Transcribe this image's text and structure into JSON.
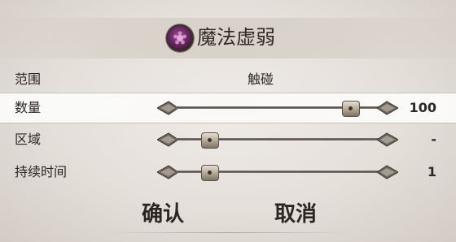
{
  "dialog": {
    "title": "魔法虚弱",
    "icon": "magic-weakness-icon"
  },
  "rows": [
    {
      "label": "范围",
      "value": "触碰"
    },
    {
      "label": "数量",
      "value": "100",
      "slider_fraction": 0.91
    },
    {
      "label": "区域",
      "value": "-",
      "slider_fraction": 0.11
    },
    {
      "label": "持续时间",
      "value": "1",
      "slider_fraction": 0.11
    }
  ],
  "buttons": {
    "confirm": "确认",
    "cancel": "取消"
  },
  "colors": {
    "background": "#e6e1db",
    "text": "#2c2724",
    "icon_purple": "#7a3670"
  }
}
